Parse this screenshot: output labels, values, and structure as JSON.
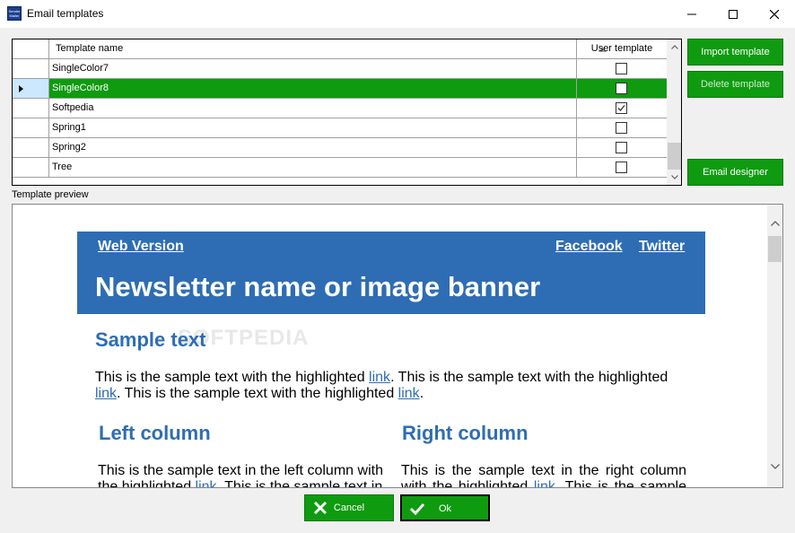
{
  "window": {
    "title": "Email templates",
    "icon_text": "Sender Mailer"
  },
  "grid": {
    "columns": {
      "name": "Template name",
      "user": "User template"
    },
    "rows": [
      {
        "name": "SingleColor7",
        "user_template": false,
        "selected": false
      },
      {
        "name": "SingleColor8",
        "user_template": false,
        "selected": true
      },
      {
        "name": "Softpedia",
        "user_template": true,
        "selected": false
      },
      {
        "name": "Spring1",
        "user_template": false,
        "selected": false
      },
      {
        "name": "Spring2",
        "user_template": false,
        "selected": false
      },
      {
        "name": "Tree",
        "user_template": false,
        "selected": false
      }
    ]
  },
  "buttons": {
    "import": "Import template",
    "delete": "Delete template",
    "designer": "Email designer",
    "cancel": "Cancel",
    "ok": "Ok"
  },
  "preview": {
    "label": "Template preview",
    "watermark": "SOFTPEDIA",
    "web_version": "Web Version",
    "facebook": "Facebook",
    "twitter": "Twitter",
    "banner": "Newsletter name or image banner",
    "sample_heading": "Sample text",
    "p1": {
      "t1": "This is the sample text with the highlighted ",
      "l1": "link",
      "t2": ". This is the sample text with the highlighted ",
      "l2": "link",
      "t3": ". This is the sample text with the highlighted ",
      "l3": "link",
      "t4": "."
    },
    "left_heading": "Left column",
    "right_heading": "Right column",
    "left_p": {
      "t1": "This is the sample text in the left column with the highlighted ",
      "l1": "link",
      "t2": ". This is the sample text in"
    },
    "right_p": {
      "t1": "This is the sample text in the right column with the highlighted ",
      "l1": "link",
      "t2": ". This is the sample text in"
    }
  },
  "colors": {
    "accent_green": "#0f9b0f",
    "newsletter_blue": "#2e6db4"
  }
}
